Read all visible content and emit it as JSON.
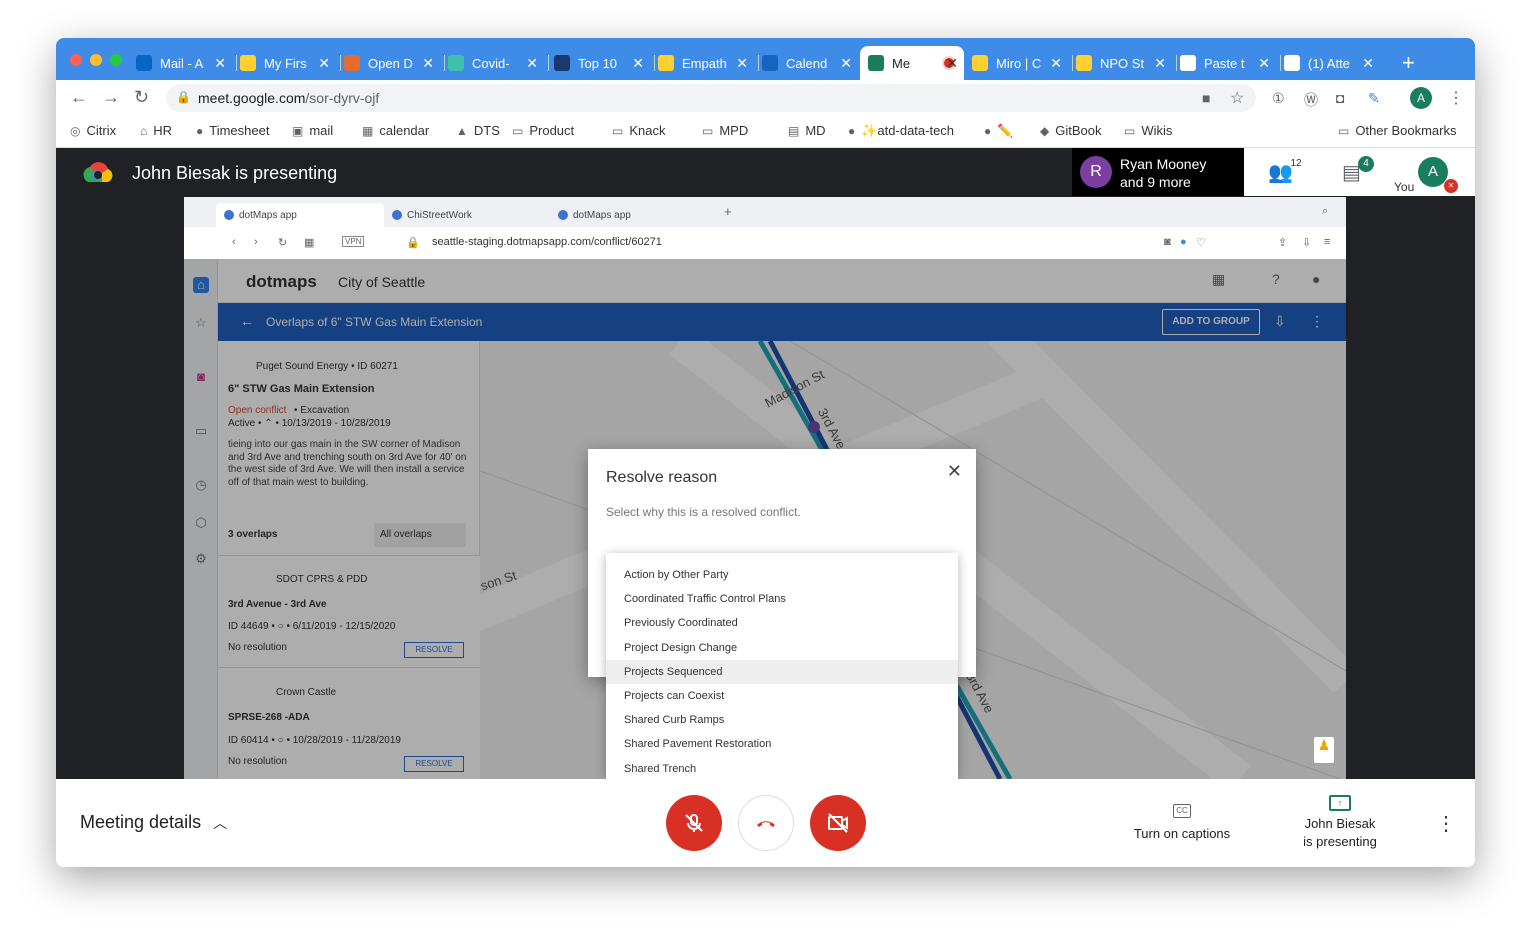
{
  "browser": {
    "tabs": [
      {
        "label": "Mail - A",
        "icon": "outlook-icon",
        "color": "#0a64c2"
      },
      {
        "label": "My Firs",
        "icon": "miro-icon",
        "color": "#ffd02f"
      },
      {
        "label": "Open D",
        "icon": "open-data-icon",
        "color": "#e56a2f"
      },
      {
        "label": "Covid-",
        "icon": "stat-icon",
        "color": "#3ec1a8"
      },
      {
        "label": "Top 10",
        "icon": "globe-icon",
        "color": "#1a3a6b"
      },
      {
        "label": "Empath",
        "icon": "miro-icon",
        "color": "#ffd02f"
      },
      {
        "label": "Calend",
        "icon": "calendar-icon",
        "color": "#1565c0"
      },
      {
        "label": "Me",
        "icon": "meet-icon",
        "color": "#1a7e5e",
        "active": true
      },
      {
        "label": "Miro | C",
        "icon": "miro-icon",
        "color": "#ffd02f"
      },
      {
        "label": "NPO St",
        "icon": "miro-icon",
        "color": "#ffd02f"
      },
      {
        "label": "Paste t",
        "icon": "clipboard-icon",
        "color": "#ffffff"
      },
      {
        "label": "(1) Atte",
        "icon": "github-icon",
        "color": "#ffffff"
      }
    ],
    "url_host": "meet.google.com",
    "url_path": "/sor-dyrv-ojf",
    "profile_initial": "A",
    "bookmarks": [
      {
        "label": "Citrix",
        "icon": "citrix-icon"
      },
      {
        "label": "HR",
        "icon": "hr-icon"
      },
      {
        "label": "Timesheet",
        "icon": "globe-icon"
      },
      {
        "label": "mail",
        "icon": "outlook-icon"
      },
      {
        "label": "calendar",
        "icon": "calendar-icon"
      },
      {
        "label": "DTS",
        "icon": "drive-icon"
      },
      {
        "label": "Product",
        "icon": "folder-icon"
      },
      {
        "label": "Knack",
        "icon": "folder-icon"
      },
      {
        "label": "MPD",
        "icon": "folder-icon"
      },
      {
        "label": "MD",
        "icon": "md-icon"
      },
      {
        "label": "✨atd-data-tech",
        "icon": "github-icon"
      },
      {
        "label": "✏️",
        "icon": "github-icon"
      },
      {
        "label": "GitBook",
        "icon": "gitbook-icon"
      },
      {
        "label": "Wikis",
        "icon": "folder-icon"
      }
    ],
    "other_bookmarks": "Other Bookmarks"
  },
  "meet": {
    "presenting_title": "John Biesak is presenting",
    "participant_name": "Ryan Mooney",
    "participant_more": "and 9 more",
    "participant_initial": "R",
    "people_count": "12",
    "chat_count": "4",
    "you_label": "You",
    "you_initial": "A",
    "meeting_details": "Meeting details",
    "captions_label": "Turn on captions",
    "presenter_line1": "John Biesak",
    "presenter_line2": "is presenting"
  },
  "shared": {
    "tabs": [
      "dotMaps app",
      "ChiStreetWork",
      "dotMaps app"
    ],
    "url": "seattle-staging.dotmapsapp.com/conflict/60271",
    "brand": "dotmaps",
    "city": "City of Seattle",
    "bar_title": "Overlaps of 6\" STW Gas Main Extension",
    "add_to_group": "ADD TO GROUP",
    "owner_line": "Puget Sound Energy • ID 60271",
    "project_title": "6\" STW Gas Main Extension",
    "status_open": "Open conflict",
    "status_type": "•  Excavation",
    "status_active": "Active  •  ⌃  •  10/13/2019 - 10/28/2019",
    "description": "tieing into our gas main in the SW corner of Madison and 3rd Ave and trenching south on 3rd Ave for 40' on the west side of 3rd Ave. We will then install a service off of that main west to building.",
    "overlaps_count": "3 overlaps",
    "overlaps_filter": "All overlaps",
    "cards": [
      {
        "agency": "SDOT CPRS & PDD",
        "title": "3rd Avenue - 3rd Ave",
        "dates": "ID 44649  •  ○  •  6/11/2019 - 12/15/2020",
        "resolution": "No resolution",
        "action": "RESOLVE"
      },
      {
        "agency": "Crown Castle",
        "title": "SPRSE-268 -ADA",
        "dates": "ID 60414  •  ○  •  10/28/2019 - 11/28/2019",
        "resolution": "No resolution",
        "action": "RESOLVE"
      }
    ],
    "map_labels": [
      "Madison St",
      "3rd Ave",
      "son St",
      "3rd Ave"
    ],
    "dialog": {
      "title": "Resolve reason",
      "subtitle": "Select why this is a resolved conflict.",
      "close": "✕"
    },
    "reasons": [
      "Action by Other Party",
      "Coordinated Traffic Control Plans",
      "Previously Coordinated",
      "Project Design Change",
      "Projects Sequenced",
      "Projects can Coexist",
      "Shared Curb Ramps",
      "Shared Pavement Restoration",
      "Shared Trench"
    ],
    "hovered_reason_index": 4
  }
}
